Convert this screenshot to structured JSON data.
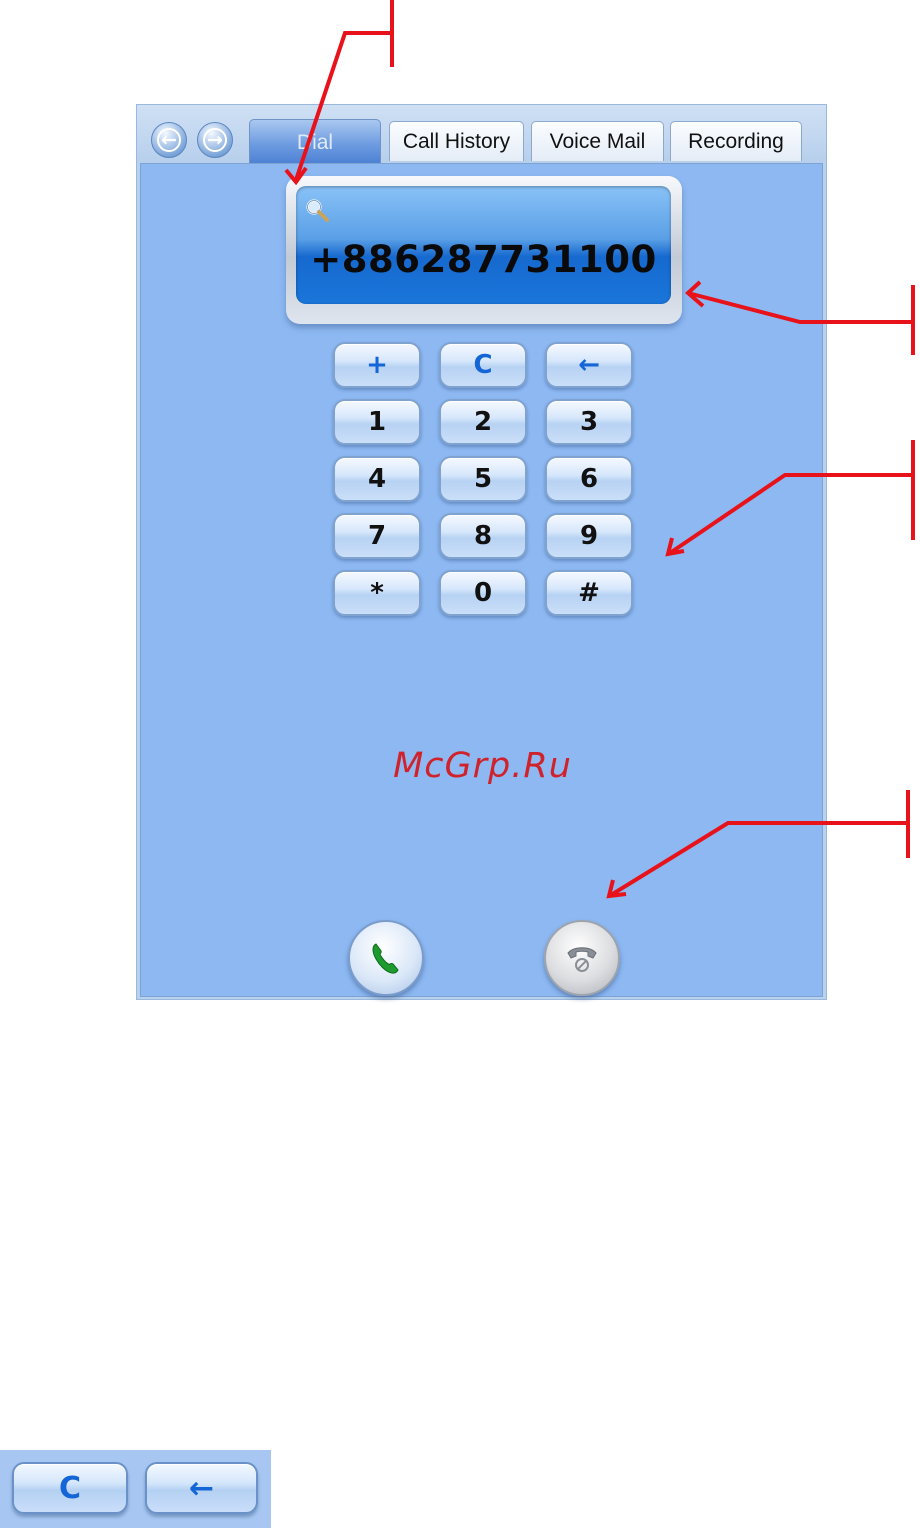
{
  "tabs": [
    {
      "label": "Dial",
      "active": true
    },
    {
      "label": "Call History"
    },
    {
      "label": "Voice Mail"
    },
    {
      "label": "Recording"
    }
  ],
  "nav": {
    "back_icon": "arrow-left-icon",
    "forward_icon": "arrow-right-icon"
  },
  "display": {
    "number": "+886287731100",
    "icon": "search-icon"
  },
  "keypad": {
    "rows": [
      [
        "+",
        "C",
        "←"
      ],
      [
        "1",
        "2",
        "3"
      ],
      [
        "4",
        "5",
        "6"
      ],
      [
        "7",
        "8",
        "9"
      ],
      [
        "*",
        "0",
        "#"
      ]
    ]
  },
  "watermark": "McGrp.Ru",
  "call_controls": {
    "call_icon": "phone-call-icon",
    "hangup_icon": "phone-hangup-icon"
  },
  "bottom_strip": {
    "clear_label": "C",
    "backspace_label": "←"
  },
  "colors": {
    "panel": "#8db8f2",
    "accent": "#1466d6",
    "watermark": "#d0222b",
    "arrows": "#e8121a"
  }
}
